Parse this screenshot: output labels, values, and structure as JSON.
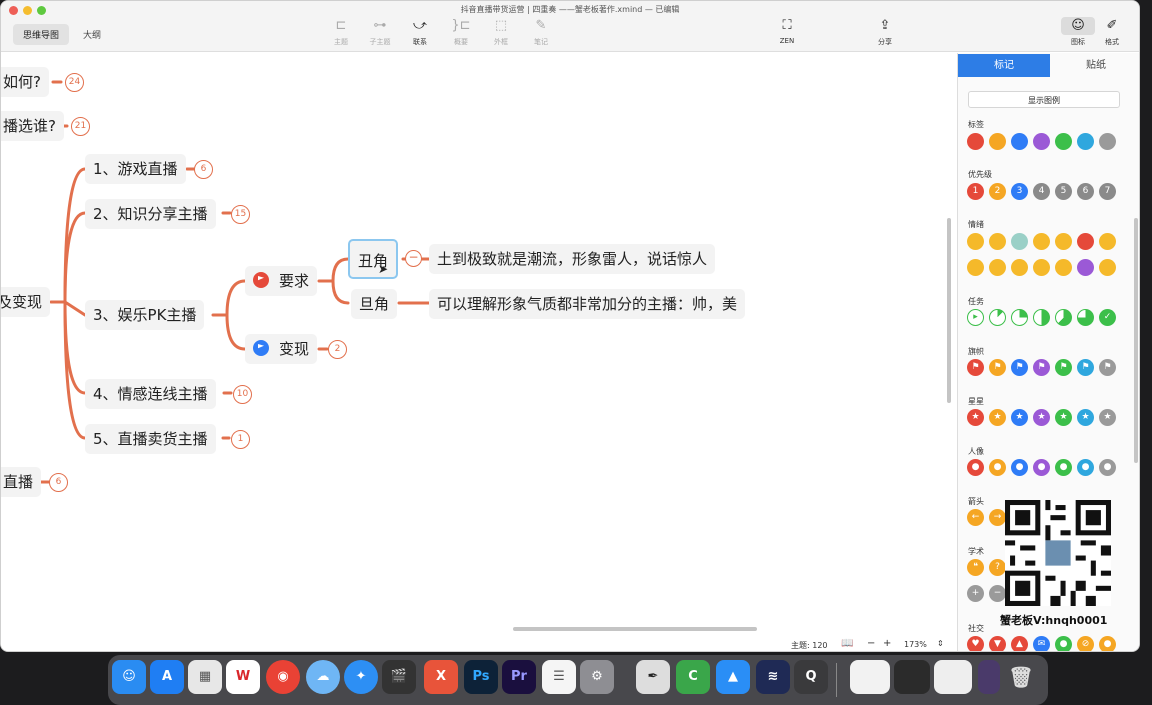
{
  "window": {
    "title": "抖音直播带货运营 | 四重奏 ——蟹老板著作.xmind — 已编辑"
  },
  "view_tabs": [
    {
      "label": "思维导图",
      "active": true
    },
    {
      "label": "大纲",
      "active": false
    }
  ],
  "toolbar": {
    "topic": "主题",
    "subtopic": "子主题",
    "relationship": "联系",
    "summary": "概要",
    "boundary": "外框",
    "note": "笔记",
    "zen": "ZEN",
    "share": "分享",
    "icon": "图标",
    "format": "格式"
  },
  "mindmap": {
    "n_how": {
      "text": "如何?",
      "count": "24"
    },
    "n_who": {
      "text": "播选谁?",
      "count": "21"
    },
    "n_realize": {
      "text": "及变现"
    },
    "n_live": {
      "text": "直播",
      "count": "6"
    },
    "n_game": {
      "text": "1、游戏直播",
      "count": "6"
    },
    "n_know": {
      "text": "2、知识分享主播",
      "count": "15"
    },
    "n_pk": {
      "text": "3、娱乐PK主播"
    },
    "n_emotion": {
      "text": "4、情感连线主播",
      "count": "10"
    },
    "n_sell": {
      "text": "5、直播卖货主播",
      "count": "1"
    },
    "n_require": {
      "text": "要求"
    },
    "n_bianxian": {
      "text": "变现",
      "count": "2"
    },
    "n_chou": {
      "text": "丑角"
    },
    "n_dan": {
      "text": "旦角"
    },
    "n_chou_desc": {
      "text": "土到极致就是潮流，形象雷人，说话惊人"
    },
    "n_dan_desc": {
      "text": "可以理解形象气质都非常加分的主播：帅，美"
    }
  },
  "status": {
    "topics": "主题: 120",
    "zoom_minus": "−",
    "zoom_plus": "+",
    "zoom": "173%"
  },
  "panel": {
    "tab_marker": "标记",
    "tab_sticker": "贴纸",
    "show_legend": "显示图例",
    "labels": {
      "tag": "标签",
      "priority": "优先级",
      "mood": "情绪",
      "task": "任务",
      "flag": "旗帜",
      "star": "星星",
      "people": "人像",
      "arrow": "箭头",
      "academic": "学术",
      "social": "社交"
    },
    "priority_nums": [
      "1",
      "2",
      "3",
      "4",
      "5",
      "6",
      "7"
    ],
    "tag_colors": [
      "#e5493a",
      "#f5a623",
      "#2f7cf6",
      "#9b59d6",
      "#3cbf4a",
      "#2fa7de",
      "#9a9a9a"
    ]
  },
  "watermark": {
    "caption": "蟹老板V:hnqh0001"
  },
  "dock": [
    {
      "label": "Finder",
      "icon": "finder-icon",
      "color": "#2a8cf2"
    },
    {
      "label": "App Store",
      "icon": "appstore-icon",
      "color": "#1f7ef3"
    },
    {
      "label": "Launchpad",
      "icon": "launchpad-icon",
      "color": "#e7e7e7"
    },
    {
      "label": "WPS",
      "icon": "wps-icon",
      "color": "#ffffff"
    },
    {
      "label": "Chrome",
      "icon": "chrome-icon",
      "color": "#e94235"
    },
    {
      "label": "Weather",
      "icon": "cloud-icon",
      "color": "#6fb6f5"
    },
    {
      "label": "Safari",
      "icon": "safari-icon",
      "color": "#2d8ff4"
    },
    {
      "label": "Final Cut",
      "icon": "finalcut-icon",
      "color": "#333333"
    },
    {
      "label": "XMind",
      "icon": "xmind-icon",
      "color": "#e8543a"
    },
    {
      "label": "Ps",
      "icon": "ps-icon",
      "color": "#0d2238"
    },
    {
      "label": "Pr",
      "icon": "pr-icon",
      "color": "#1a0f3e"
    },
    {
      "label": "Reminders",
      "icon": "list-icon",
      "color": "#f5f5f5"
    },
    {
      "label": "Settings",
      "icon": "gear-icon",
      "color": "#8e8e93"
    },
    {
      "label": "Pen",
      "icon": "pen-icon",
      "color": "#dddddd"
    },
    {
      "label": "Camtasia",
      "icon": "camtasia-icon",
      "color": "#3aa64a"
    },
    {
      "label": "Keynote",
      "icon": "keynote-icon",
      "color": "#2a8ef6"
    },
    {
      "label": "Wave",
      "icon": "wave-icon",
      "color": "#1f2a55"
    },
    {
      "label": "QuickTime",
      "icon": "quicktime-icon",
      "color": "#3a3a3c"
    }
  ]
}
